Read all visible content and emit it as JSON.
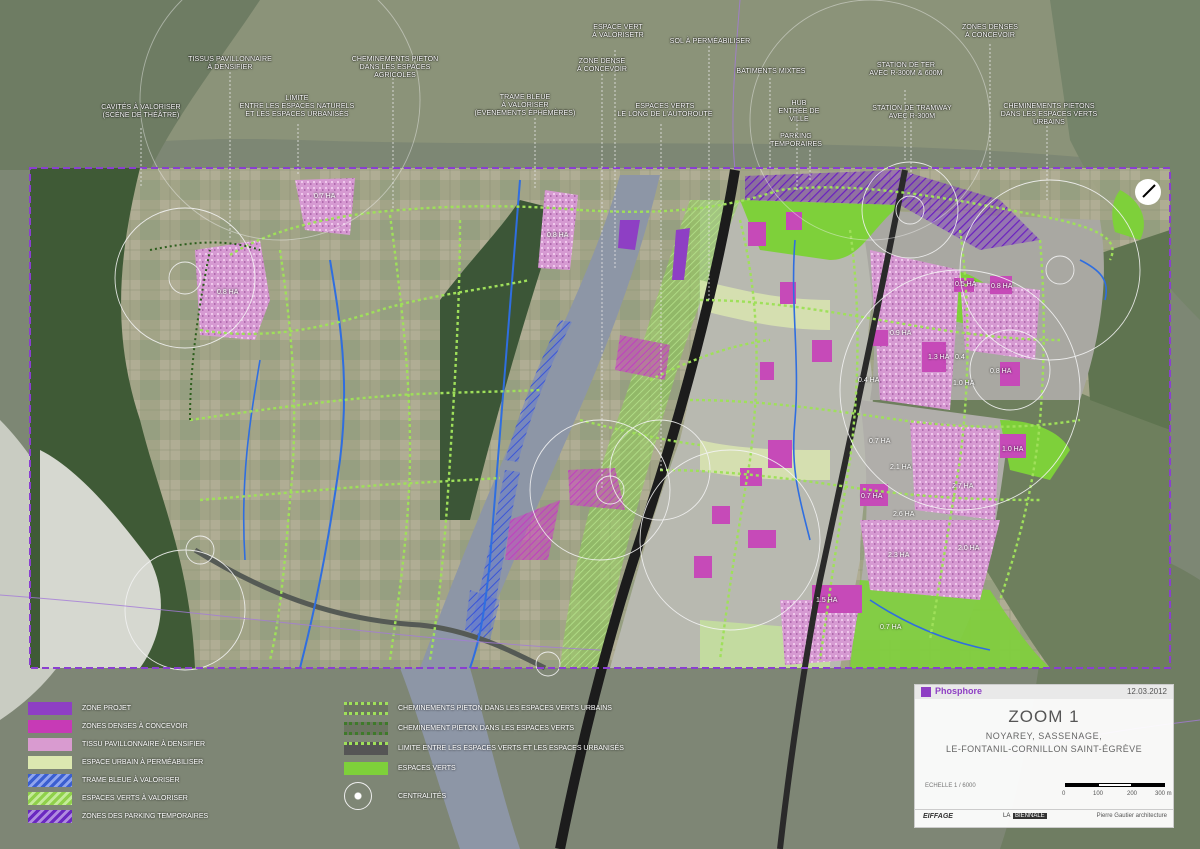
{
  "callouts": [
    {
      "id": "cavites",
      "text": "CAVITÉS À VALORISER\n(SCÈNE DE THÉÂTRE)"
    },
    {
      "id": "tissus",
      "text": "TISSUS PAVILLONNAIRE\nÀ DENSIFIER"
    },
    {
      "id": "limite",
      "text": "LIMITE\nENTRE LES ESPACES NATURELS\nET LES ESPACES URBANISÉS"
    },
    {
      "id": "chem-agri",
      "text": "CHEMINEMENTS PIETON\nDANS LES ESPACES AGRICOLES"
    },
    {
      "id": "trame",
      "text": "TRAME BLEUE\nÀ VALORISER\n(EVENEMENTS ÉPHÉMÈRES)"
    },
    {
      "id": "zone-dense",
      "text": "ZONE DENSE\nÀ CONCEVOIR"
    },
    {
      "id": "espace-vert",
      "text": "ESPACE VERT\nÀ VALORISETR"
    },
    {
      "id": "sol",
      "text": "SOL À PERMÉABILISER"
    },
    {
      "id": "ev-autoroute",
      "text": "ESPACES VERTS\nLE LONG DE L'AUTOROUTE"
    },
    {
      "id": "batiments",
      "text": "BATIMENTS MIXTES"
    },
    {
      "id": "hub",
      "text": "HUB\nENTRÉE DE VILLE"
    },
    {
      "id": "parking",
      "text": "PARKING\nTEMPORAIRES"
    },
    {
      "id": "ter",
      "text": "STATION DE TER\nAVEC R-300M & 600M"
    },
    {
      "id": "tram",
      "text": "STATION DE TRAMWAY\nAVEC R-300M"
    },
    {
      "id": "zones-denses",
      "text": "ZONES DENSES\nÀ CONCEVOIR"
    },
    {
      "id": "chem-urbains",
      "text": "CHEMINEMENTS PIETONS\nDANS LES ESPACES VERTS URBAINS"
    }
  ],
  "areas": [
    {
      "id": "a1",
      "text": "0.8 HA"
    },
    {
      "id": "a2",
      "text": "0.7 HA"
    },
    {
      "id": "a3",
      "text": "0.8 HA"
    },
    {
      "id": "a4",
      "text": "0.5 HA"
    },
    {
      "id": "a5",
      "text": "0.8 HA"
    },
    {
      "id": "a6",
      "text": "0.9 HA"
    },
    {
      "id": "a7",
      "text": "1.3 HA"
    },
    {
      "id": "a8",
      "text": "0.4"
    },
    {
      "id": "a9",
      "text": "0.4 HA"
    },
    {
      "id": "a10",
      "text": "1.0 HA"
    },
    {
      "id": "a11",
      "text": "0.8 HA"
    },
    {
      "id": "a12",
      "text": "0.7 HA"
    },
    {
      "id": "a13",
      "text": "2.1 HA"
    },
    {
      "id": "a14",
      "text": "1.0 HA"
    },
    {
      "id": "a15",
      "text": "0.7 HA"
    },
    {
      "id": "a16",
      "text": "2.7 HA"
    },
    {
      "id": "a17",
      "text": "2.3 HA"
    },
    {
      "id": "a18",
      "text": "2.0 HA"
    },
    {
      "id": "a19",
      "text": "2.6 HA"
    },
    {
      "id": "a20",
      "text": "1.5 HA"
    },
    {
      "id": "a21",
      "text": "0.7 HA"
    }
  ],
  "legend_left": [
    {
      "id": "zone-projet",
      "label": "ZONE PROJET",
      "color": "#8e3fc4"
    },
    {
      "id": "zones-denses",
      "label": "ZONES DENSES À CONCEVOIR",
      "color": "#c73ab6"
    },
    {
      "id": "tissu",
      "label": "TISSU PAVILLONNAIRE À DENSIFIER",
      "color": "#d99bd0"
    },
    {
      "id": "espace-urbain",
      "label": "ESPACE URBAIN À PERMÉABILISER",
      "color": "#dce8b0"
    },
    {
      "id": "trame-bleue",
      "label": "TRAME BLEUE À VALORISER",
      "color": "#3b5fd0"
    },
    {
      "id": "ev-valoriser",
      "label": "ESPACES VERTS À VALORISER",
      "color": "#8fd04a"
    },
    {
      "id": "parking",
      "label": "ZONES DES PARKING TEMPORAIRES",
      "color": "#6a28c0"
    }
  ],
  "legend_right": [
    {
      "id": "chem-urbains",
      "label": "CHEMINEMENTS PIETON DANS LES ESPACES VERTS URBAINS"
    },
    {
      "id": "chem-ev",
      "label": "CHEMINEMENT PIETON DANS LES ESPACES VERTS"
    },
    {
      "id": "limite",
      "label": "LIMITE ENTRE LES ESPACES VERTS ET LES ESPACES URBANISÉS"
    },
    {
      "id": "ev",
      "label": "ESPACES VERTS",
      "color": "#7ed03a"
    },
    {
      "id": "centralites",
      "label": "CENTRALITÉS"
    }
  ],
  "titlebox": {
    "brand": "Phosphore",
    "date": "12.03.2012",
    "title": "ZOOM 1",
    "subtitle1": "NOYAREY, SASSENAGE,",
    "subtitle2": "LE-FONTANIL-CORNILLON  SAINT-ÉGRÈVE",
    "scale": "ECHELLE 1 / 6000",
    "scale_ticks": [
      "0",
      "100",
      "200",
      "300 m"
    ],
    "partner1": "EIFFAGE",
    "partner2_prefix": "LA",
    "partner2": "BIENNALE",
    "architect": "Pierre Gautier architecture"
  },
  "colors": {
    "project_border": "#8a3fd0",
    "pink": "#c74ab8",
    "green": "#7dcf3b",
    "blue": "#2f6ee0"
  }
}
